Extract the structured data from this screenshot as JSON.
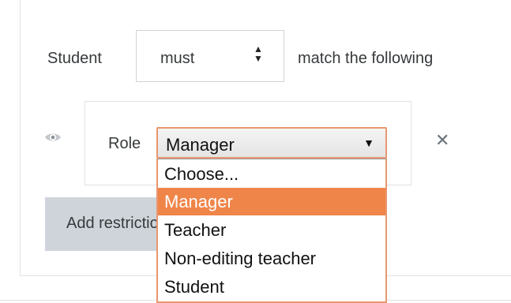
{
  "restriction": {
    "subject": "Student",
    "match_mode": "must",
    "match_suffix": "match the following"
  },
  "condition": {
    "label": "Role",
    "selected": "Manager",
    "caret": "▼",
    "remove_icon": "close-icon",
    "visibility_icon": "eye-icon"
  },
  "dropdown": {
    "options": [
      "Choose...",
      "Manager",
      "Teacher",
      "Non-editing teacher",
      "Student"
    ],
    "highlighted": "Manager"
  },
  "add_button": {
    "label": "Add restriction..."
  },
  "colors": {
    "highlight": "#f08549",
    "focus_border": "#e8976e",
    "button_bg": "#ced4da"
  }
}
